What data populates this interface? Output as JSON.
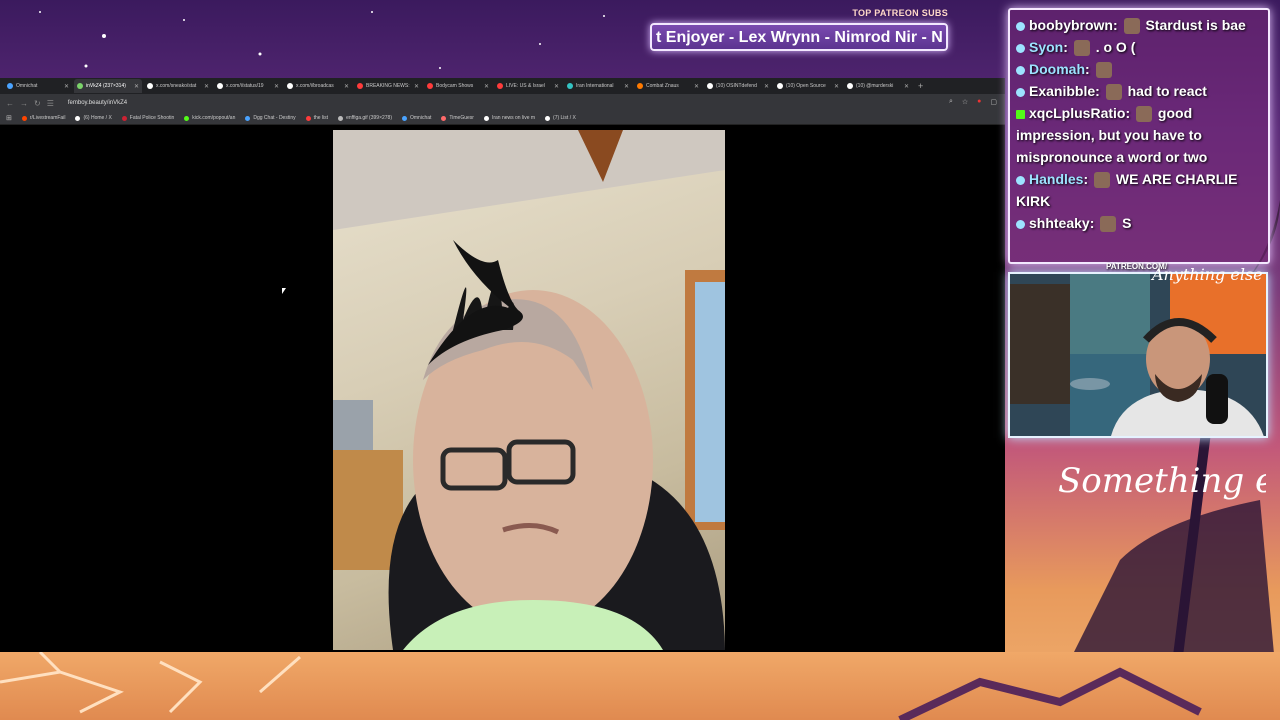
{
  "stream": {
    "patreon_label": "TOP PATREON SUBS",
    "ticker_text": "t Enjoyer - Lex Wrynn - Nimrod Nir - N",
    "patreon_url": "PATREON.COM/",
    "brand": "Anything else",
    "brand_big": "Something else"
  },
  "browser": {
    "tabs": [
      {
        "label": "Omnichat",
        "color": "#4aa3ff",
        "active": false
      },
      {
        "label": "inVkZ4 (237×314)",
        "color": "#7bd36a",
        "active": true
      },
      {
        "label": "x.com/sneako/stat",
        "color": "#ffffff",
        "active": false
      },
      {
        "label": "x.com/i/status/19",
        "color": "#ffffff",
        "active": false
      },
      {
        "label": "x.com/i/broadcas",
        "color": "#ffffff",
        "active": false
      },
      {
        "label": "BREAKING NEWS:",
        "color": "#ff3b3b",
        "active": false
      },
      {
        "label": "Bodycam Shows",
        "color": "#ff3b3b",
        "active": false
      },
      {
        "label": "LIVE: US & Israel",
        "color": "#ff3b3b",
        "active": false
      },
      {
        "label": "Iran International",
        "color": "#33c3c3",
        "active": false
      },
      {
        "label": "Combat Znaus",
        "color": "#ff7a00",
        "active": false
      },
      {
        "label": "(10) OSINTdefend",
        "color": "#ffffff",
        "active": false
      },
      {
        "label": "(10) Open Source",
        "color": "#ffffff",
        "active": false
      },
      {
        "label": "(10) @murderski",
        "color": "#ffffff",
        "active": false
      }
    ],
    "url": "femboy.beauty/inVkZ4",
    "bookmarks": [
      {
        "label": "r/LivestreamFail",
        "color": "#ff4500"
      },
      {
        "label": "(6) Home / X",
        "color": "#ffffff"
      },
      {
        "label": "Fatal Police Shootin",
        "color": "#cc2233"
      },
      {
        "label": "kick.com/popout/an",
        "color": "#53fc18"
      },
      {
        "label": "Dgg Chat - Destiny",
        "color": "#4aa3ff"
      },
      {
        "label": "the list",
        "color": "#ff3b3b"
      },
      {
        "label": "enffiga.gif (399×278)",
        "color": "#bbbbbb"
      },
      {
        "label": "Omnichat",
        "color": "#4aa3ff"
      },
      {
        "label": "TimeGuesr",
        "color": "#ff6a6a"
      },
      {
        "label": "Iran news on live m",
        "color": "#ffffff"
      },
      {
        "label": "(7) List / X",
        "color": "#ffffff"
      }
    ]
  },
  "chat": {
    "messages": [
      {
        "user": "boobybrown",
        "text": "Stardust is bae",
        "user_color": "#ffffff",
        "platform": "twitch"
      },
      {
        "user": "Syon",
        "text": ". o O (",
        "user_color": "#9de3ff",
        "platform": "twitch"
      },
      {
        "user": "Doomah",
        "text": "",
        "user_color": "#9de3ff",
        "platform": "twitch"
      },
      {
        "user": "Exanibble",
        "text": "had to react",
        "user_color": "#ffffff",
        "platform": "twitch"
      },
      {
        "user": "xqcLplusRatio",
        "text": "good impression, but you have to mispronounce a word or two",
        "user_color": "#ffffff",
        "platform": "kick"
      },
      {
        "user": "Handles",
        "text": "WE ARE CHARLIE KIRK",
        "user_color": "#9de3ff",
        "platform": "twitch"
      },
      {
        "user": "shhteaky",
        "text": "S",
        "user_color": "#ffffff",
        "platform": "twitch"
      }
    ]
  }
}
